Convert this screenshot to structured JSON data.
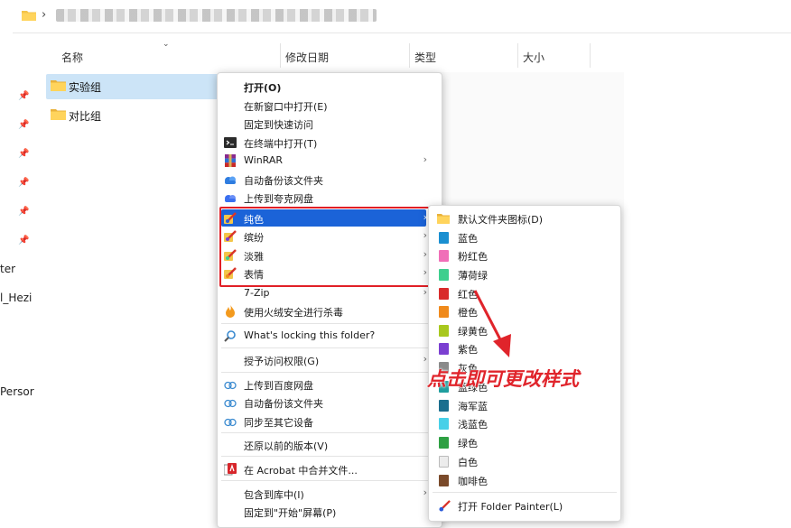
{
  "nav": {
    "partial_labels": [
      "ter",
      "l_Hezi",
      "Persor"
    ]
  },
  "columns": {
    "name": "名称",
    "modified": "修改日期",
    "type": "类型",
    "size": "大小"
  },
  "files": [
    {
      "name": "实验组",
      "selected": true
    },
    {
      "name": "对比组",
      "selected": false
    }
  ],
  "context_menu": {
    "items": [
      {
        "label": "打开(O)",
        "bold": true
      },
      {
        "label": "在新窗口中打开(E)"
      },
      {
        "label": "固定到快速访问"
      },
      {
        "label": "在终端中打开(T)"
      },
      {
        "label": "WinRAR"
      },
      {
        "label": "自动备份该文件夹"
      },
      {
        "label": "上传到夸克网盘"
      },
      {
        "label": "纯色"
      },
      {
        "label": "缤纷"
      },
      {
        "label": "淡雅"
      },
      {
        "label": "表情"
      },
      {
        "label": "7-Zip"
      },
      {
        "label": "使用火绒安全进行杀毒"
      },
      {
        "label": "What's locking this folder?"
      },
      {
        "label": "授予访问权限(G)"
      },
      {
        "label": "上传到百度网盘"
      },
      {
        "label": "自动备份该文件夹"
      },
      {
        "label": "同步至其它设备"
      },
      {
        "label": "还原以前的版本(V)"
      },
      {
        "label": "在 Acrobat 中合并文件..."
      },
      {
        "label": "包含到库中(I)"
      },
      {
        "label": "固定到\"开始\"屏幕(P)"
      }
    ]
  },
  "submenu": {
    "items": [
      {
        "label": "默认文件夹图标(D)",
        "color": "#f6c342"
      },
      {
        "label": "蓝色",
        "color": "#1a8fd1"
      },
      {
        "label": "粉红色",
        "color": "#f06fb8"
      },
      {
        "label": "薄荷绿",
        "color": "#3ecf8e"
      },
      {
        "label": "红色",
        "color": "#d92b2b"
      },
      {
        "label": "橙色",
        "color": "#f08a1c"
      },
      {
        "label": "绿黄色",
        "color": "#a8c81e"
      },
      {
        "label": "紫色",
        "color": "#7b3fd1"
      },
      {
        "label": "灰色",
        "color": "#8a8a8a"
      },
      {
        "label": "蓝绿色",
        "color": "#1f9e9e"
      },
      {
        "label": "海军蓝",
        "color": "#1b6e8e"
      },
      {
        "label": "浅蓝色",
        "color": "#48d0e8"
      },
      {
        "label": "绿色",
        "color": "#2ea043"
      },
      {
        "label": "白色",
        "color": "#ececec"
      },
      {
        "label": "咖啡色",
        "color": "#7a4a2a"
      }
    ],
    "footer": "打开 Folder Painter(L)"
  },
  "annotation": "点击即可更改样式",
  "accent": "#1b63d8",
  "highlight_box_color": "#e11f26"
}
